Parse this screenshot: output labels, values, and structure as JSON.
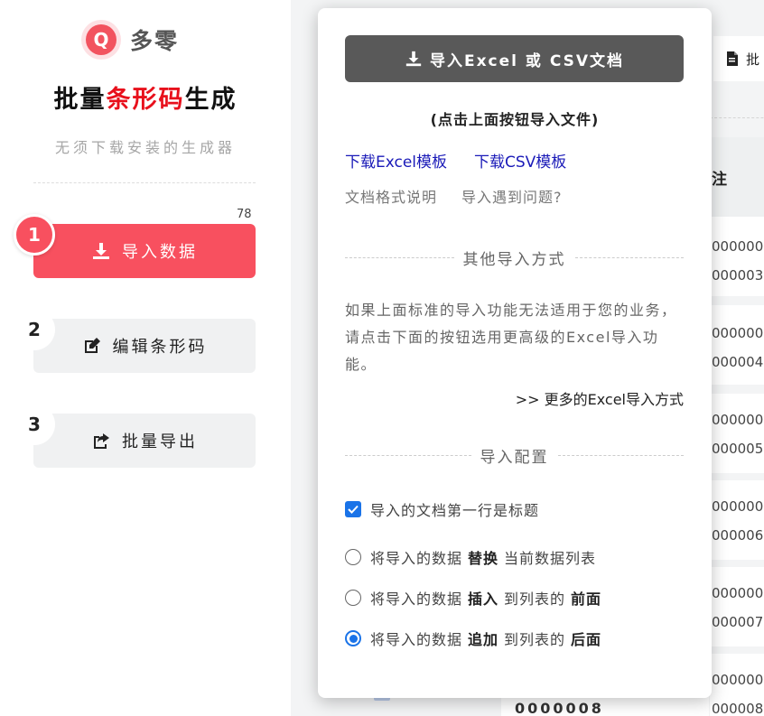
{
  "logo": {
    "letter": "Q",
    "name": "多零"
  },
  "title": {
    "part1": "批量",
    "highlight": "条形码",
    "part2": "生成"
  },
  "subtitle": "无须下载安装的生成器",
  "count": "78",
  "steps": [
    {
      "num": "1",
      "label": "导入数据",
      "icon": "download-icon"
    },
    {
      "num": "2",
      "label": "编辑条形码",
      "icon": "edit-icon"
    },
    {
      "num": "3",
      "label": "批量导出",
      "icon": "share-icon"
    }
  ],
  "background": {
    "top_button": "批",
    "header": "注",
    "rows": [
      {
        "a": "000000",
        "b": "000003"
      },
      {
        "a": "000000",
        "b": "000004"
      },
      {
        "a": "000000",
        "b": "000005"
      },
      {
        "a": "000000",
        "b": "000006"
      },
      {
        "a": "000000",
        "b": "000007"
      },
      {
        "a": "000000",
        "b": "000008"
      }
    ],
    "bottom_text": "0000008"
  },
  "modal": {
    "import_button": "导入Excel 或 CSV文档",
    "hint": "(点击上面按钮导入文件)",
    "download_excel": "下载Excel模板",
    "download_csv": "下载CSV模板",
    "format_help": "文档格式说明",
    "import_problem": "导入遇到问题?",
    "other_section": "其他导入方式",
    "other_desc": "如果上面标准的导入功能无法适用于您的业务，请点击下面的按钮选用更高级的Excel导入功能。",
    "more_link": ">> 更多的Excel导入方式",
    "config_section": "导入配置",
    "first_row_header": "导入的文档第一行是标题",
    "first_row_checked": true,
    "options": [
      {
        "pre": "将导入的数据",
        "bold": "替换",
        "mid": "当前数据列表",
        "bold2": "",
        "selected": false
      },
      {
        "pre": "将导入的数据",
        "bold": "插入",
        "mid": "到列表的",
        "bold2": "前面",
        "selected": false
      },
      {
        "pre": "将导入的数据",
        "bold": "追加",
        "mid": "到列表的",
        "bold2": "后面",
        "selected": true
      }
    ]
  }
}
